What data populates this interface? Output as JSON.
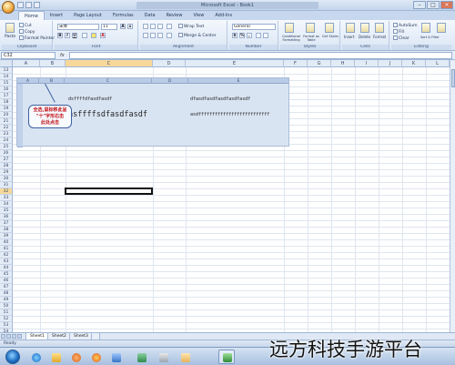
{
  "window": {
    "title": "Microsoft Excel - Book1",
    "controls": [
      "–",
      "□",
      "×"
    ]
  },
  "tabs": [
    "Home",
    "Insert",
    "Page Layout",
    "Formulas",
    "Data",
    "Review",
    "View",
    "Add-Ins"
  ],
  "ribbon": {
    "clipboard": {
      "paste": "Paste",
      "cut": "Cut",
      "copy": "Copy",
      "format_painter": "Format Painter",
      "name": "Clipboard"
    },
    "font": {
      "family": "宋体",
      "size": "11",
      "name": "Font",
      "grow": "A",
      "shrink": "A",
      "bold": "B",
      "italic": "I",
      "underline": "U"
    },
    "alignment": {
      "wrap": "Wrap Text",
      "merge": "Merge & Center",
      "name": "Alignment"
    },
    "number": {
      "format": "General",
      "percent": "%",
      "comma": ",",
      "name": "Number"
    },
    "styles": {
      "conditional": "Conditional Formatting",
      "table": "Format as Table",
      "cell": "Cell Styles",
      "name": "Styles"
    },
    "cells": {
      "insert": "Insert",
      "delete": "Delete",
      "format": "Format",
      "name": "Cells"
    },
    "editing": {
      "autosum": "AutoSum",
      "fill": "Fill",
      "clear": "Clear",
      "sort": "Sort & Filter",
      "find": "Find & Select",
      "name": "Editing"
    }
  },
  "formula_bar": {
    "name_box": "C32",
    "fx": "fx",
    "value": ""
  },
  "columns": [
    "A",
    "B",
    "C",
    "D",
    "E",
    "F",
    "G",
    "H",
    "I",
    "J",
    "K",
    "L"
  ],
  "rows": [
    "13",
    "14",
    "15",
    "16",
    "17",
    "18",
    "19",
    "20",
    "21",
    "22",
    "23",
    "24",
    "25",
    "26",
    "27",
    "28",
    "29",
    "30",
    "31",
    "32",
    "33",
    "34",
    "35",
    "36",
    "37",
    "38",
    "39",
    "40",
    "41",
    "42",
    "43",
    "44",
    "45",
    "46",
    "47",
    "48",
    "49",
    "50",
    "51",
    "52",
    "53",
    "54",
    "55"
  ],
  "selected": {
    "column": "C",
    "row": "32"
  },
  "embedded": {
    "cols": [
      "A",
      "B",
      "C",
      "D",
      "E"
    ],
    "text_small_left": "dsffffdfasdfasdf",
    "text_large_left": "asffffsdfasdfasdf",
    "text_small_right": "dfasdfasdfasdfasdfasdf",
    "text_right_row2": "asdffffffffffffffffffffffffff",
    "callout": "全选,鼠标移此呈\n\"十\"字形右击\n此处点击"
  },
  "sheet_tabs": [
    "Sheet1",
    "Sheet2",
    "Sheet3"
  ],
  "status": {
    "text": "Ready"
  },
  "taskbar_icons": [
    "ie-icon",
    "folder-icon",
    "media-icon",
    "firefox-icon",
    "app-icon",
    "app2-icon",
    "app3-icon",
    "mail-icon",
    "excel-icon"
  ],
  "watermark": "远方科技手游平台"
}
